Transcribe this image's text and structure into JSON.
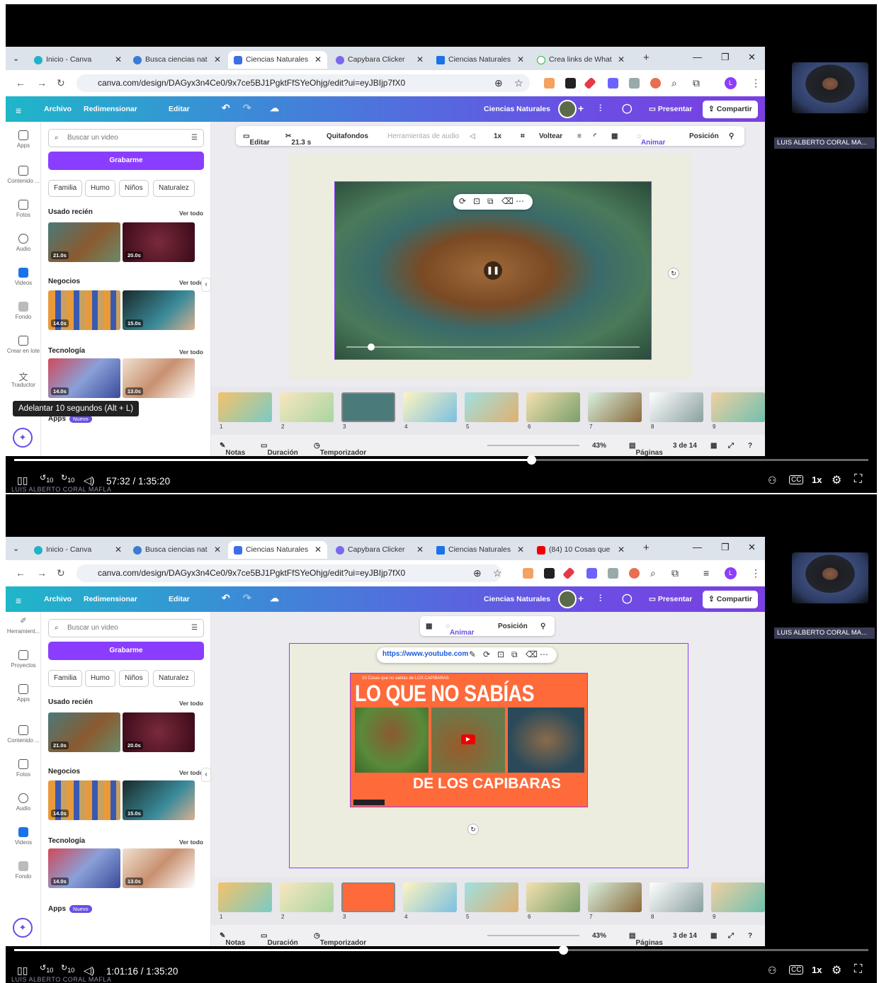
{
  "browser": {
    "tabs_top": [
      "Inicio - Canva",
      "Busca ciencias nat",
      "Ciencias Naturales",
      "Capybara Clicker",
      "Ciencias Naturales",
      "Crea links de What"
    ],
    "tabs_bottom": [
      "Inicio - Canva",
      "Busca ciencias nat",
      "Ciencias Naturales",
      "Capybara Clicker",
      "Ciencias Naturales",
      "(84) 10 Cosas que"
    ],
    "url": "canva.com/design/DAGyx3n4Ce0/9x7ce5BJ1PgktFfSYeOhjg/edit?ui=eyJBIjp7fX0",
    "avatar_letter": "L"
  },
  "canva": {
    "menu": {
      "file": "Archivo",
      "resize": "Redimensionar",
      "edit": "Editar"
    },
    "title": "Ciencias Naturales",
    "present": "Presentar",
    "share": "Compartir",
    "rail_top": [
      "Apps",
      "Contenido ...",
      "Fotos",
      "Audio",
      "Videos",
      "Fondo",
      "Crear en lote",
      "Traductor"
    ],
    "rail_bottom": [
      "Herramient...",
      "Proyectos",
      "Apps",
      "Contenido ...",
      "Fotos",
      "Audio",
      "Videos",
      "Fondo"
    ],
    "search_placeholder": "Buscar un video",
    "record": "Grabarme",
    "chips": [
      "Familia",
      "Humo",
      "Niños",
      "Naturalez"
    ],
    "sections": {
      "recent": "Usado recién",
      "business": "Negocios",
      "tech": "Tecnología",
      "apps": "Apps",
      "new_badge": "Nuevo",
      "see_all": "Ver todo"
    },
    "durations": [
      "21.0s",
      "20.0s",
      "14.0s",
      "15.0s",
      "14.0s",
      "13.0s"
    ],
    "toolbar1": {
      "edit": "Editar",
      "trim": "21.3 s",
      "bgremove": "Quitafondos",
      "audio": "Herramientas de audio",
      "speed": "1x",
      "flip": "Voltear",
      "animate": "Animar",
      "position": "Posición"
    },
    "toolbar2": {
      "animate": "Animar",
      "position": "Posición"
    },
    "link_pill": "https://www.youtube.com",
    "yt_title_top": "LO QUE NO SABÍAS",
    "yt_title_bottom": "DE LOS CAPIBARAS",
    "yt_small": "10 Cosas que no sabías de LOS CAPIBARAS",
    "pages": [
      "1",
      "2",
      "3",
      "4",
      "5",
      "6",
      "7",
      "8",
      "9"
    ],
    "footer": {
      "notes": "Notas",
      "duration": "Duración",
      "timer": "Temporizador",
      "zoom": "43%",
      "pages": "Páginas",
      "page_count": "3 de 14"
    }
  },
  "player": {
    "top": {
      "time": "57:32 / 1:35:20",
      "progress": 0.605,
      "tooltip": "Adelantar 10 segundos (Alt + L)"
    },
    "bottom": {
      "time": "1:01:16 / 1:35:20",
      "progress": 0.643
    },
    "speed": "1x",
    "watermark": "LUIS ALBERTO CORAL MAFLA",
    "skip": "10"
  },
  "participant": {
    "name": "LUIS ALBERTO CORAL MA..."
  }
}
